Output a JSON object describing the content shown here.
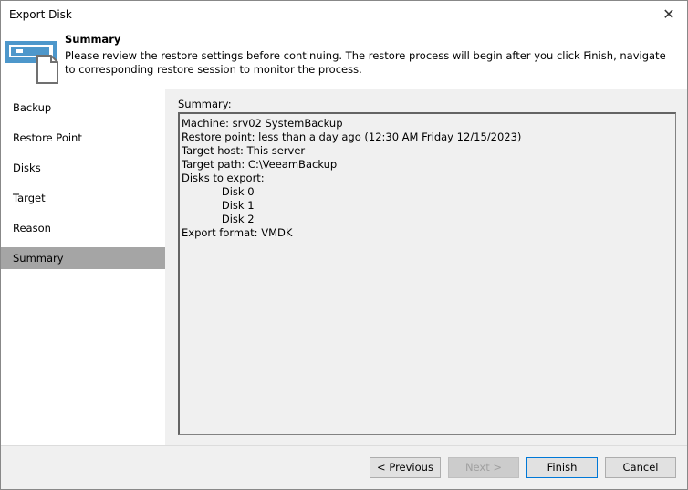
{
  "window": {
    "title": "Export Disk"
  },
  "header": {
    "title": "Summary",
    "description": "Please review the restore settings before continuing. The restore process will begin after you click Finish, navigate to corresponding restore session to monitor the process."
  },
  "sidebar": {
    "items": [
      {
        "label": "Backup"
      },
      {
        "label": "Restore Point"
      },
      {
        "label": "Disks"
      },
      {
        "label": "Target"
      },
      {
        "label": "Reason"
      },
      {
        "label": "Summary",
        "selected": true
      }
    ]
  },
  "main": {
    "summary_label": "Summary:",
    "summary_text": "Machine: srv02 SystemBackup\nRestore point: less than a day ago (12:30 AM Friday 12/15/2023)\nTarget host: This server\nTarget path: C:\\VeeamBackup\nDisks to export:\n            Disk 0\n            Disk 1\n            Disk 2\nExport format: VMDK"
  },
  "footer": {
    "previous": "< Previous",
    "next": "Next >",
    "finish": "Finish",
    "cancel": "Cancel"
  }
}
